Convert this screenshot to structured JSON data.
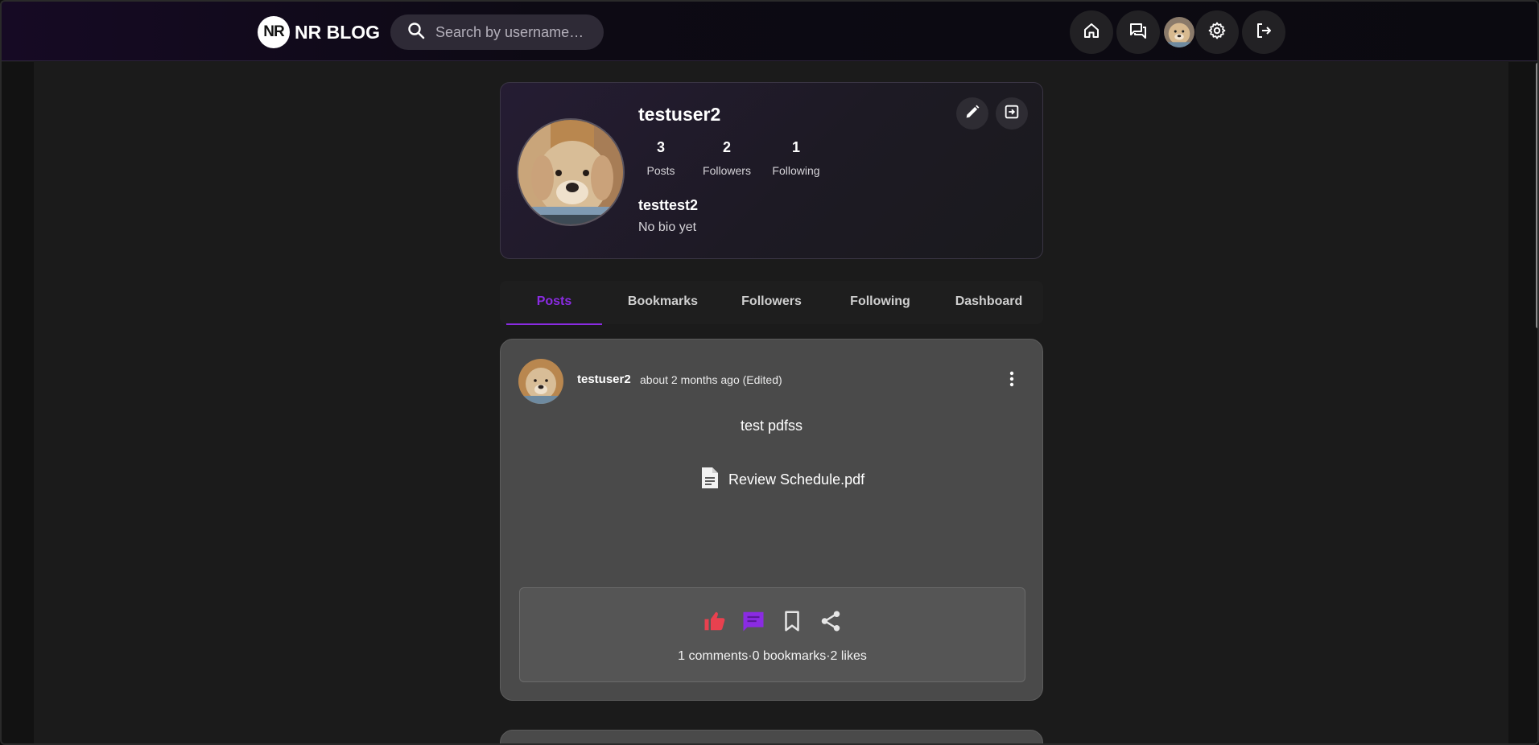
{
  "header": {
    "logo_badge": "NR",
    "logo_text": "NR BLOG",
    "search_placeholder": "Search by username…",
    "nav_icons": [
      "home-icon",
      "forum-icon",
      "avatar",
      "gear-icon",
      "logout-icon"
    ]
  },
  "profile": {
    "username": "testuser2",
    "stats": [
      {
        "value": "3",
        "label": "Posts"
      },
      {
        "value": "2",
        "label": "Followers"
      },
      {
        "value": "1",
        "label": "Following"
      }
    ],
    "display_name": "testtest2",
    "bio": "No bio yet",
    "action_icons": [
      "edit-icon",
      "exit-icon"
    ]
  },
  "tabs": [
    "Posts",
    "Bookmarks",
    "Followers",
    "Following",
    "Dashboard"
  ],
  "active_tab": "Posts",
  "post": {
    "username": "testuser2",
    "time": "about 2 months ago (Edited)",
    "text": "test pdfss",
    "attachment": "Review Schedule.pdf",
    "counts": "1 comments·0 bookmarks·2 likes",
    "action_icons": [
      "like-icon",
      "comment-icon",
      "bookmark-icon",
      "share-icon"
    ]
  },
  "colors": {
    "accent": "#8a2be2",
    "like": "#e8414f",
    "card": "#4a4a4a"
  }
}
